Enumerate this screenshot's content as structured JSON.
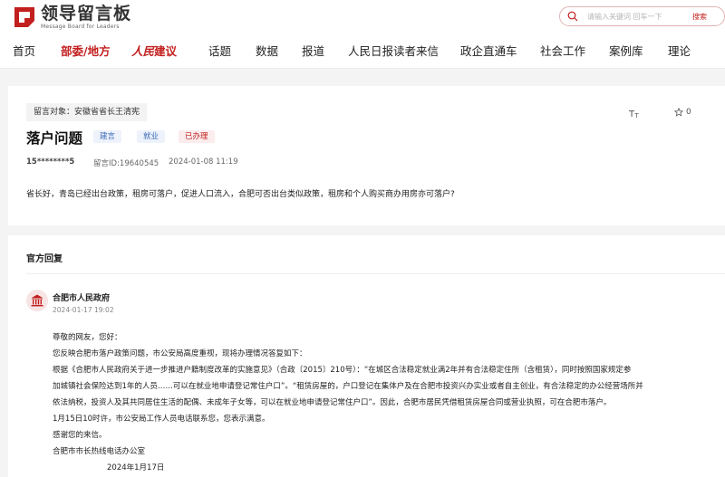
{
  "header": {
    "logo_title": "领导留言板",
    "logo_subtitle": "Message Board for Leaders",
    "search_placeholder": "请输入关键词 回车一下",
    "search_button": "搜索"
  },
  "nav": {
    "items": [
      "首页",
      "部委/地方",
      "人民建议",
      "话题",
      "数据",
      "报道",
      "人民日报读者来信",
      "政企直通车",
      "社会工作",
      "案例库",
      "理论"
    ],
    "brand_part1": "人民",
    "brand_part2": "建议"
  },
  "message": {
    "target": "留言对象：安徽省省长王清宪",
    "title": "落户问题",
    "tags": [
      "建言",
      "就业",
      "已办理"
    ],
    "user": "15********5",
    "message_id": "留言ID:19640545",
    "time": "2024-01-08 11:19",
    "favorite_count": "0",
    "content": "省长好，青岛已经出台政策，租房可落户，促进人口流入，合肥可否出台类似政策，租房和个人购买商办用房亦可落户?"
  },
  "reply": {
    "heading": "官方回复",
    "org": "合肥市人民政府",
    "time": "2024-01-17 19:02",
    "lines": [
      "尊敬的网友，您好：",
      "您反映合肥市落户政策问题，市公安局高度重视，现将办理情况答复如下：",
      "根据《合肥市人民政府关于进一步推进户籍制度改革的实施意见》（合政〔2015〕210号）：“在城区合法稳定就业满2年并有合法稳定住所（含租赁），同时按照国家规定参",
      "加城镇社会保险达到1年的人员……可以在就业地申请登记常住户口”。“租赁房屋的，户口登记在集体户及在合肥市投资兴办实业或者自主创业，有合法稳定的办公经营场所并",
      "依法纳税，投资人及其共同居住生活的配偶、未成年子女等，可以在就业地申请登记常住户口”。因此，合肥市居民凭借租赁房屋合同或营业执照，可在合肥市落户。",
      "1月15日10时许，市公安局工作人员电话联系您，您表示满意。",
      "感谢您的来信。",
      "合肥市市长热线电话办公室",
      "2024年1月17日"
    ]
  },
  "colors": {
    "brand_red": "#c21f1f",
    "tag_blue": "#3d6bb8",
    "page_bg": "#f4f4f4"
  },
  "icons": [
    "logo-mark-icon",
    "search-icon",
    "font-size-icon",
    "star-icon",
    "government-building-icon"
  ]
}
